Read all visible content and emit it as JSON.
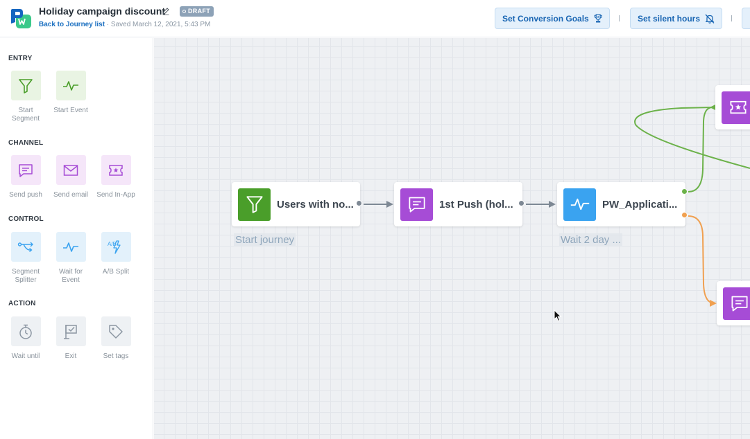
{
  "header": {
    "title": "Holiday campaign discount",
    "status_badge": "DRAFT",
    "back_link": "Back to Journey list",
    "saved_text": "· Saved March 12, 2021, 5:43 PM",
    "buttons": {
      "conversion_goals": "Set Conversion Goals",
      "silent_hours": "Set silent hours"
    }
  },
  "sidebar": {
    "sections": {
      "entry": "ENTRY",
      "channel": "CHANNEL",
      "control": "CONTROL",
      "action": "ACTION"
    },
    "tools": {
      "start_segment": "Start Segment",
      "start_event": "Start Event",
      "send_push": "Send push",
      "send_email": "Send email",
      "send_inapp": "Send In-App",
      "segment_splitter": "Segment Splitter",
      "wait_for_event": "Wait for Event",
      "ab_split": "A/B Split",
      "wait_until": "Wait until",
      "exit": "Exit",
      "set_tags": "Set tags"
    },
    "ab_icon_text": "A/B"
  },
  "canvas": {
    "nodes": {
      "segment": "Users with no...",
      "push": "1st Push (hol...",
      "event": "PW_Applicati..."
    },
    "captions": {
      "start": "Start journey",
      "wait": "Wait 2 day ..."
    }
  },
  "colors": {
    "entry_green": "#4a9e2a",
    "channel_purple": "#a64cd6",
    "control_blue": "#3aa3f0",
    "accent_blue": "#1a6fc0",
    "branch_yes": "#6cb24a",
    "branch_no": "#f0a050"
  }
}
